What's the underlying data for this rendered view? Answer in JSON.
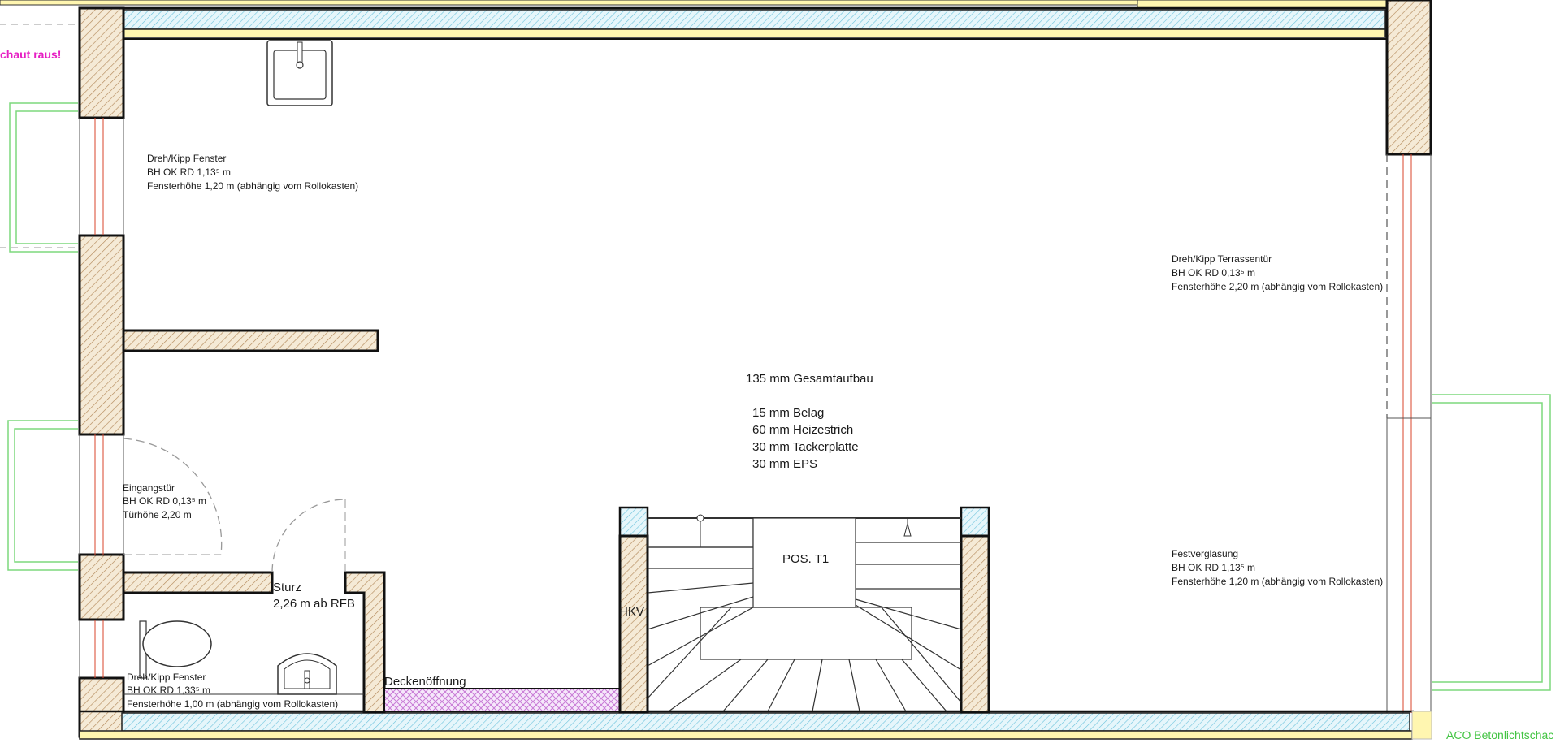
{
  "colors": {
    "wall_fill": "#f5ead6",
    "wall_hatch": "#b48a5c",
    "insulation": "#8fd3e6",
    "yellow_band": "#fff6b0",
    "window_frame": "#7dd87d",
    "window_glass": "#d9442b",
    "magenta": "#e61ec3",
    "opening_hatch": "#c87ad6",
    "green_label": "#43c443"
  },
  "labels": {
    "warning": "chaut raus!",
    "aco": "ACO Betonlichtschac",
    "window_top_left": [
      "Dreh/Kipp Fenster",
      "BH OK RD 1,13⁵ m",
      "Fensterhöhe 1,20 m (abhängig vom Rollokasten)"
    ],
    "terrace_door": [
      "Dreh/Kipp Terrassentür",
      "BH OK RD 0,13⁵ m",
      "Fensterhöhe 2,20 m (abhängig vom Rollokasten)"
    ],
    "floor_build": {
      "total": "135 mm Gesamtaufbau",
      "layers": [
        "15 mm Belag",
        "60 mm Heizestrich",
        "30 mm Tackerplatte",
        "30 mm EPS"
      ]
    },
    "entrance_door": [
      "Eingangstür",
      "BH OK RD 0,13⁵ m",
      "Türhöhe 2,20 m"
    ],
    "lintel": [
      "Sturz",
      "2,26 m ab RFB"
    ],
    "fixed_glazing": [
      "Festverglasung",
      "BH OK RD 1,13⁵ m",
      "Fensterhöhe 1,20 m (abhängig vom Rollokasten)"
    ],
    "stair_pos": "POS. T1",
    "hkv": "HKV",
    "ceiling_opening": "Deckenöffnung",
    "window_bottom_left": [
      "Dreh/Kipp Fenster",
      "BH OK RD 1,33⁵ m",
      "Fensterhöhe 1,00 m (abhängig vom Rollokasten)"
    ]
  },
  "icons": [
    "sink-icon",
    "toilet-icon",
    "washbasin-icon",
    "stair-direction-arrow-icon"
  ]
}
